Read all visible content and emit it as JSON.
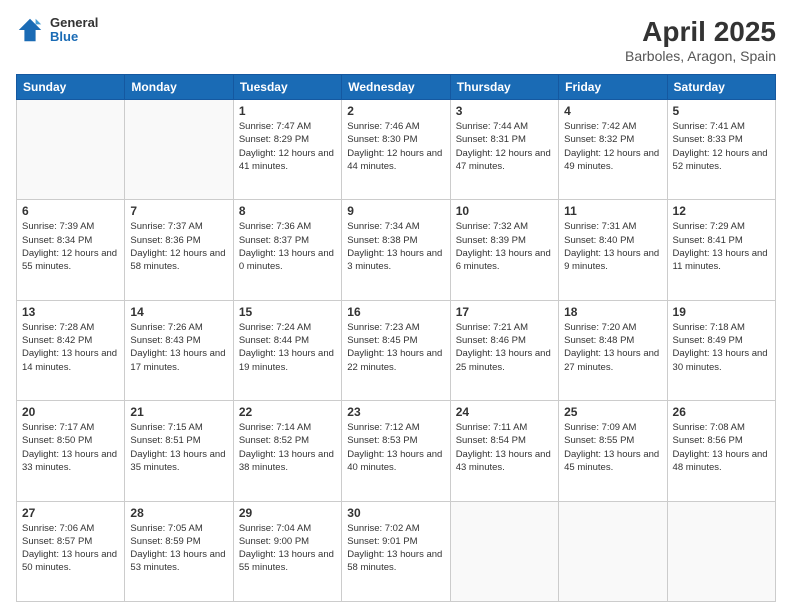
{
  "header": {
    "logo_line1": "General",
    "logo_line2": "Blue",
    "title": "April 2025",
    "subtitle": "Barboles, Aragon, Spain"
  },
  "weekdays": [
    "Sunday",
    "Monday",
    "Tuesday",
    "Wednesday",
    "Thursday",
    "Friday",
    "Saturday"
  ],
  "weeks": [
    [
      {
        "day": "",
        "sunrise": "",
        "sunset": "",
        "daylight": ""
      },
      {
        "day": "",
        "sunrise": "",
        "sunset": "",
        "daylight": ""
      },
      {
        "day": "1",
        "sunrise": "Sunrise: 7:47 AM",
        "sunset": "Sunset: 8:29 PM",
        "daylight": "Daylight: 12 hours and 41 minutes."
      },
      {
        "day": "2",
        "sunrise": "Sunrise: 7:46 AM",
        "sunset": "Sunset: 8:30 PM",
        "daylight": "Daylight: 12 hours and 44 minutes."
      },
      {
        "day": "3",
        "sunrise": "Sunrise: 7:44 AM",
        "sunset": "Sunset: 8:31 PM",
        "daylight": "Daylight: 12 hours and 47 minutes."
      },
      {
        "day": "4",
        "sunrise": "Sunrise: 7:42 AM",
        "sunset": "Sunset: 8:32 PM",
        "daylight": "Daylight: 12 hours and 49 minutes."
      },
      {
        "day": "5",
        "sunrise": "Sunrise: 7:41 AM",
        "sunset": "Sunset: 8:33 PM",
        "daylight": "Daylight: 12 hours and 52 minutes."
      }
    ],
    [
      {
        "day": "6",
        "sunrise": "Sunrise: 7:39 AM",
        "sunset": "Sunset: 8:34 PM",
        "daylight": "Daylight: 12 hours and 55 minutes."
      },
      {
        "day": "7",
        "sunrise": "Sunrise: 7:37 AM",
        "sunset": "Sunset: 8:36 PM",
        "daylight": "Daylight: 12 hours and 58 minutes."
      },
      {
        "day": "8",
        "sunrise": "Sunrise: 7:36 AM",
        "sunset": "Sunset: 8:37 PM",
        "daylight": "Daylight: 13 hours and 0 minutes."
      },
      {
        "day": "9",
        "sunrise": "Sunrise: 7:34 AM",
        "sunset": "Sunset: 8:38 PM",
        "daylight": "Daylight: 13 hours and 3 minutes."
      },
      {
        "day": "10",
        "sunrise": "Sunrise: 7:32 AM",
        "sunset": "Sunset: 8:39 PM",
        "daylight": "Daylight: 13 hours and 6 minutes."
      },
      {
        "day": "11",
        "sunrise": "Sunrise: 7:31 AM",
        "sunset": "Sunset: 8:40 PM",
        "daylight": "Daylight: 13 hours and 9 minutes."
      },
      {
        "day": "12",
        "sunrise": "Sunrise: 7:29 AM",
        "sunset": "Sunset: 8:41 PM",
        "daylight": "Daylight: 13 hours and 11 minutes."
      }
    ],
    [
      {
        "day": "13",
        "sunrise": "Sunrise: 7:28 AM",
        "sunset": "Sunset: 8:42 PM",
        "daylight": "Daylight: 13 hours and 14 minutes."
      },
      {
        "day": "14",
        "sunrise": "Sunrise: 7:26 AM",
        "sunset": "Sunset: 8:43 PM",
        "daylight": "Daylight: 13 hours and 17 minutes."
      },
      {
        "day": "15",
        "sunrise": "Sunrise: 7:24 AM",
        "sunset": "Sunset: 8:44 PM",
        "daylight": "Daylight: 13 hours and 19 minutes."
      },
      {
        "day": "16",
        "sunrise": "Sunrise: 7:23 AM",
        "sunset": "Sunset: 8:45 PM",
        "daylight": "Daylight: 13 hours and 22 minutes."
      },
      {
        "day": "17",
        "sunrise": "Sunrise: 7:21 AM",
        "sunset": "Sunset: 8:46 PM",
        "daylight": "Daylight: 13 hours and 25 minutes."
      },
      {
        "day": "18",
        "sunrise": "Sunrise: 7:20 AM",
        "sunset": "Sunset: 8:48 PM",
        "daylight": "Daylight: 13 hours and 27 minutes."
      },
      {
        "day": "19",
        "sunrise": "Sunrise: 7:18 AM",
        "sunset": "Sunset: 8:49 PM",
        "daylight": "Daylight: 13 hours and 30 minutes."
      }
    ],
    [
      {
        "day": "20",
        "sunrise": "Sunrise: 7:17 AM",
        "sunset": "Sunset: 8:50 PM",
        "daylight": "Daylight: 13 hours and 33 minutes."
      },
      {
        "day": "21",
        "sunrise": "Sunrise: 7:15 AM",
        "sunset": "Sunset: 8:51 PM",
        "daylight": "Daylight: 13 hours and 35 minutes."
      },
      {
        "day": "22",
        "sunrise": "Sunrise: 7:14 AM",
        "sunset": "Sunset: 8:52 PM",
        "daylight": "Daylight: 13 hours and 38 minutes."
      },
      {
        "day": "23",
        "sunrise": "Sunrise: 7:12 AM",
        "sunset": "Sunset: 8:53 PM",
        "daylight": "Daylight: 13 hours and 40 minutes."
      },
      {
        "day": "24",
        "sunrise": "Sunrise: 7:11 AM",
        "sunset": "Sunset: 8:54 PM",
        "daylight": "Daylight: 13 hours and 43 minutes."
      },
      {
        "day": "25",
        "sunrise": "Sunrise: 7:09 AM",
        "sunset": "Sunset: 8:55 PM",
        "daylight": "Daylight: 13 hours and 45 minutes."
      },
      {
        "day": "26",
        "sunrise": "Sunrise: 7:08 AM",
        "sunset": "Sunset: 8:56 PM",
        "daylight": "Daylight: 13 hours and 48 minutes."
      }
    ],
    [
      {
        "day": "27",
        "sunrise": "Sunrise: 7:06 AM",
        "sunset": "Sunset: 8:57 PM",
        "daylight": "Daylight: 13 hours and 50 minutes."
      },
      {
        "day": "28",
        "sunrise": "Sunrise: 7:05 AM",
        "sunset": "Sunset: 8:59 PM",
        "daylight": "Daylight: 13 hours and 53 minutes."
      },
      {
        "day": "29",
        "sunrise": "Sunrise: 7:04 AM",
        "sunset": "Sunset: 9:00 PM",
        "daylight": "Daylight: 13 hours and 55 minutes."
      },
      {
        "day": "30",
        "sunrise": "Sunrise: 7:02 AM",
        "sunset": "Sunset: 9:01 PM",
        "daylight": "Daylight: 13 hours and 58 minutes."
      },
      {
        "day": "",
        "sunrise": "",
        "sunset": "",
        "daylight": ""
      },
      {
        "day": "",
        "sunrise": "",
        "sunset": "",
        "daylight": ""
      },
      {
        "day": "",
        "sunrise": "",
        "sunset": "",
        "daylight": ""
      }
    ]
  ]
}
